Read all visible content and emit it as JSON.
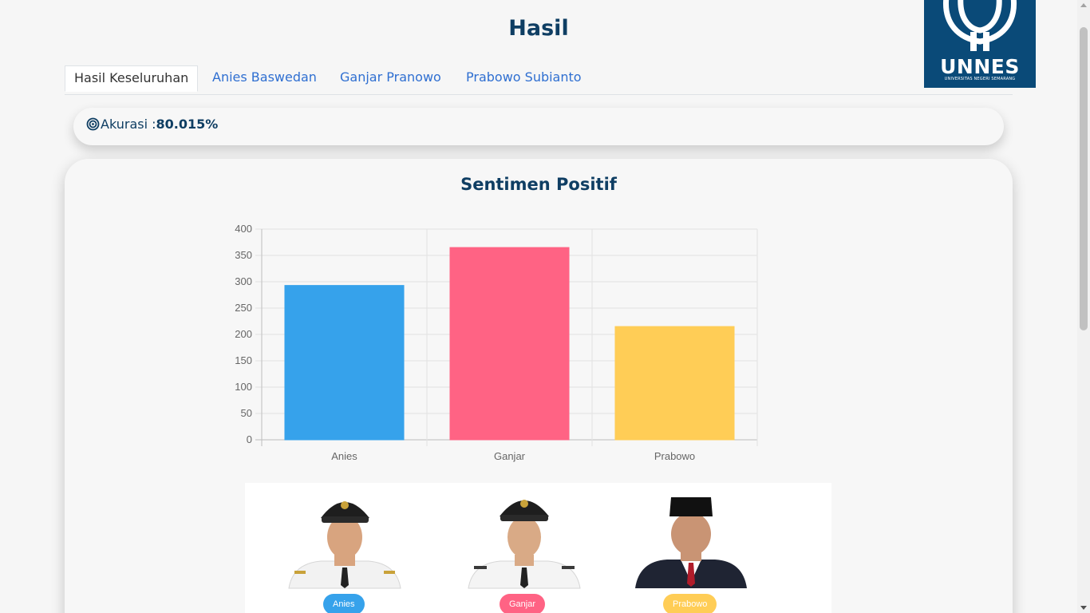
{
  "page": {
    "title": "Hasil"
  },
  "logo": {
    "name": "UNNES",
    "subtitle": "UNIVERSITAS NEGERI SEMARANG"
  },
  "tabs": [
    {
      "label": "Hasil Keseluruhan",
      "active": true
    },
    {
      "label": "Anies Baswedan",
      "active": false
    },
    {
      "label": "Ganjar Pranowo",
      "active": false
    },
    {
      "label": "Prabowo Subianto",
      "active": false
    }
  ],
  "accuracy": {
    "label": "Akurasi :",
    "value": "80.015%",
    "icon": "target-icon"
  },
  "card": {
    "title": "Sentimen Positif"
  },
  "chart_data": {
    "type": "bar",
    "categories": [
      "Anies",
      "Ganjar",
      "Prabowo"
    ],
    "values": [
      293,
      365,
      215
    ],
    "colors": [
      "#36a2eb",
      "#ff6384",
      "#ffcd56"
    ],
    "ylim": [
      0,
      400
    ],
    "yticks": [
      0,
      50,
      100,
      150,
      200,
      250,
      300,
      350,
      400
    ],
    "grid": true
  },
  "candidates": [
    {
      "name": "Anies",
      "color": "#36a2eb",
      "cap": "black-cap",
      "suit": "white-uniform"
    },
    {
      "name": "Ganjar",
      "color": "#ff6384",
      "cap": "black-cap",
      "suit": "white-uniform"
    },
    {
      "name": "Prabowo",
      "color": "#ffcd56",
      "cap": "peci",
      "suit": "dark-suit"
    }
  ]
}
